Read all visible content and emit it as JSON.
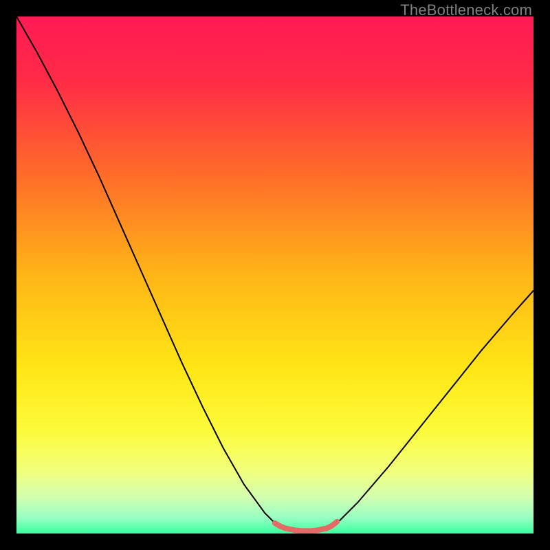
{
  "watermark": "TheBottleneck.com",
  "chart_data": {
    "type": "line",
    "title": "",
    "xlabel": "",
    "ylabel": "",
    "xlim": [
      0,
      100
    ],
    "ylim": [
      0,
      100
    ],
    "gradient_stops": [
      {
        "offset": 0.0,
        "color": "#ff1a54"
      },
      {
        "offset": 0.12,
        "color": "#ff2a47"
      },
      {
        "offset": 0.3,
        "color": "#ff6a2a"
      },
      {
        "offset": 0.5,
        "color": "#ffb517"
      },
      {
        "offset": 0.68,
        "color": "#ffe615"
      },
      {
        "offset": 0.8,
        "color": "#fcfb3a"
      },
      {
        "offset": 0.88,
        "color": "#f1ff7d"
      },
      {
        "offset": 0.93,
        "color": "#d2ffb0"
      },
      {
        "offset": 0.97,
        "color": "#96ffc2"
      },
      {
        "offset": 1.0,
        "color": "#37ff9e"
      }
    ],
    "series": [
      {
        "name": "bottleneck-curve",
        "stroke": "#000000",
        "stroke_width": 2,
        "x": [
          0,
          4,
          8,
          12,
          16,
          20,
          24,
          28,
          32,
          36,
          40,
          44,
          48,
          50,
          52,
          54,
          56,
          58,
          60,
          62,
          66,
          72,
          78,
          84,
          90,
          96,
          100
        ],
        "values": [
          100,
          93,
          85.5,
          77.5,
          69,
          60,
          51,
          42,
          33,
          24.5,
          16.5,
          9.5,
          4,
          2,
          1,
          0.6,
          0.6,
          0.6,
          0.8,
          2,
          6,
          13,
          20.5,
          28,
          35.5,
          42.5,
          47
        ]
      },
      {
        "name": "optimal-zone-marker",
        "stroke": "#e46a66",
        "stroke_width": 8,
        "x": [
          50,
          51,
          52,
          53,
          54,
          55,
          56,
          57,
          58,
          59,
          60,
          61,
          62
        ],
        "values": [
          2.0,
          1.4,
          1.0,
          0.8,
          0.6,
          0.5,
          0.5,
          0.5,
          0.6,
          0.8,
          1.0,
          1.5,
          2.3
        ]
      }
    ]
  }
}
